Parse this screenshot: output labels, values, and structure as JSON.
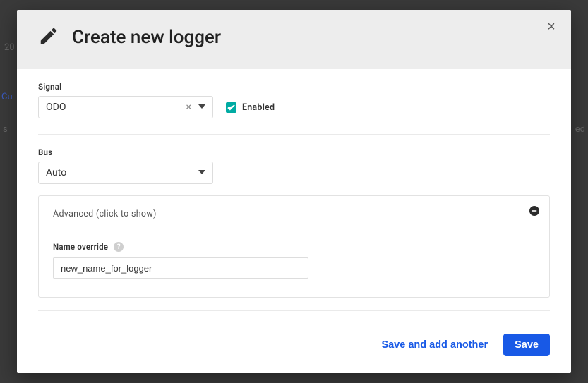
{
  "background": {
    "t1": "20",
    "t2": "Cu",
    "t3": "s",
    "t4": "ed"
  },
  "modal": {
    "title": "Create new logger",
    "close_symbol": "×",
    "signal": {
      "label": "Signal",
      "value": "ODO",
      "clear_symbol": "×"
    },
    "enabled": {
      "label": "Enabled",
      "checked": true
    },
    "bus": {
      "label": "Bus",
      "value": "Auto"
    },
    "advanced": {
      "title": "Advanced (click to show)",
      "name_override": {
        "label": "Name override",
        "value": "new_name_for_logger"
      }
    },
    "footer": {
      "save_add_another": "Save and add another",
      "save": "Save"
    }
  }
}
